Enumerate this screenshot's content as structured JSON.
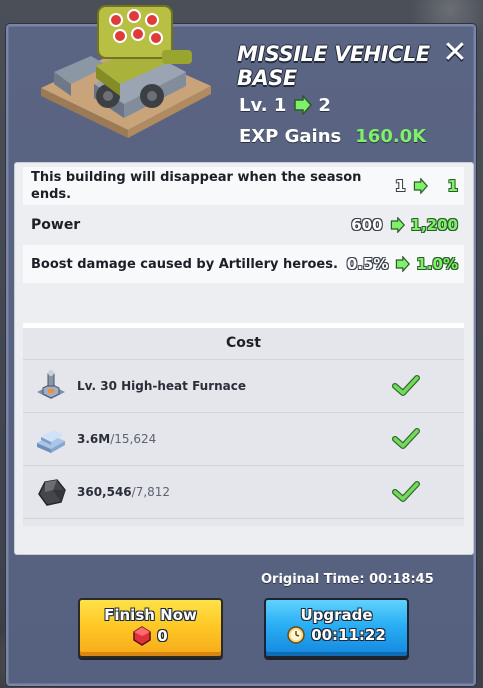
{
  "header": {
    "title": "MISSILE VEHICLE BASE",
    "close_icon": "close-icon",
    "level_label": "Lv. 1",
    "level_next": "2",
    "exp_label": "EXP Gains",
    "exp_value": "160.0K"
  },
  "stats": [
    {
      "description": "This building will disappear when the season ends.",
      "from": "1",
      "to": "1"
    },
    {
      "description": "Power",
      "from": "600",
      "to": "1,200"
    },
    {
      "description": "Boost damage caused by Artillery heroes.",
      "from": "0.5%",
      "to": "1.0%"
    }
  ],
  "cost": {
    "header": "Cost",
    "items": [
      {
        "icon": "furnace-icon",
        "text": "Lv. 30 High-heat Furnace",
        "have": "",
        "need": ""
      },
      {
        "icon": "iron-ingot-icon",
        "text": "",
        "have": "3.6M",
        "need": "/15,624"
      },
      {
        "icon": "coal-icon",
        "text": "",
        "have": "360,546",
        "need": "/7,812"
      }
    ]
  },
  "footer": {
    "original_time": "Original Time: 00:18:45",
    "finish_now_label": "Finish Now",
    "finish_now_cost": "0",
    "upgrade_label": "Upgrade",
    "upgrade_time": "00:11:22"
  },
  "colors": {
    "panel": "#5a6583",
    "accent_green": "#7ef06a",
    "finish_button": "#ffc926",
    "upgrade_button": "#2aaef3"
  }
}
